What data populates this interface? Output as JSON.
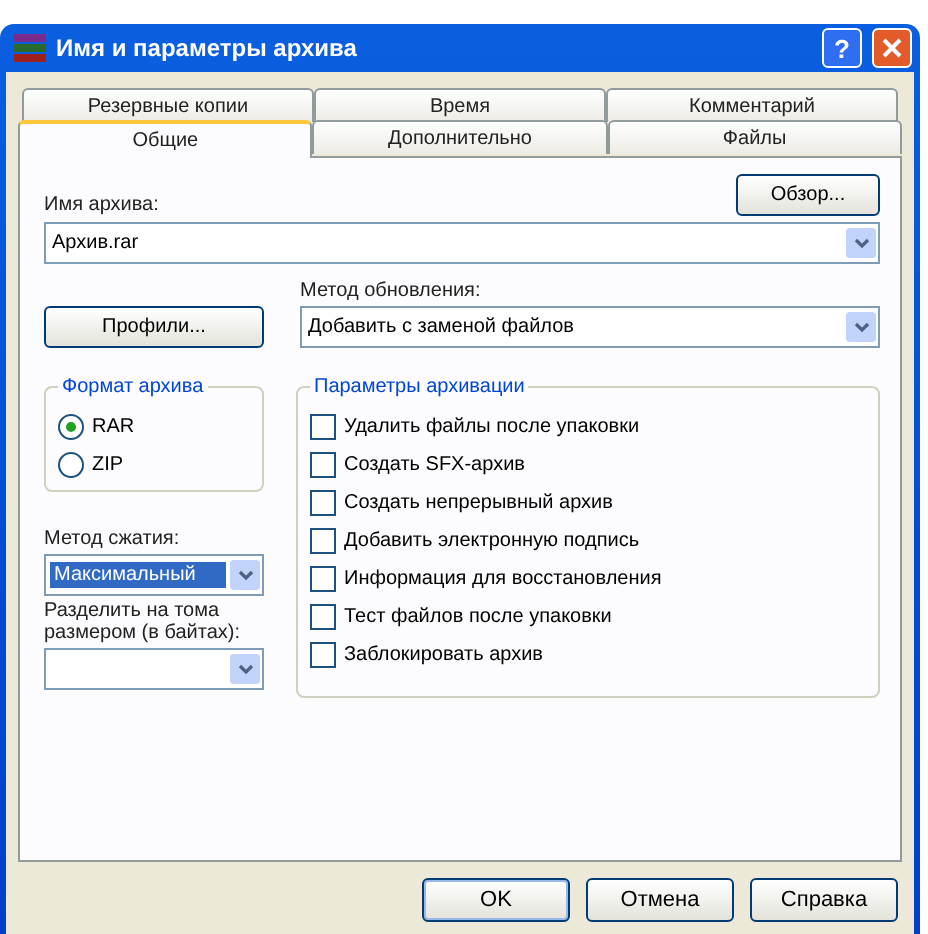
{
  "window": {
    "title": "Имя и параметры архива",
    "help": "?"
  },
  "tab_rows": [
    [
      {
        "label": "Резервные копии",
        "selected": false
      },
      {
        "label": "Время",
        "selected": false
      },
      {
        "label": "Комментарий",
        "selected": false
      }
    ],
    [
      {
        "label": "Общие",
        "selected": true
      },
      {
        "label": "Дополнительно",
        "selected": false
      },
      {
        "label": "Файлы",
        "selected": false
      }
    ]
  ],
  "archive_name": {
    "label": "Имя архива:",
    "value": "Архив.rar",
    "browse": "Обзор..."
  },
  "profiles_button": "Профили...",
  "update_method": {
    "label": "Метод обновления:",
    "value": "Добавить с заменой файлов"
  },
  "archive_format": {
    "title": "Формат архива",
    "options": [
      {
        "label": "RAR",
        "selected": true
      },
      {
        "label": "ZIP",
        "selected": false
      }
    ]
  },
  "compression_method": {
    "label": "Метод сжатия:",
    "value": "Максимальный"
  },
  "split_volumes": {
    "label": "Разделить на тома размером (в байтах):"
  },
  "archive_options": {
    "title": "Параметры архивации",
    "items": [
      {
        "label": "Удалить файлы после упаковки",
        "checked": false
      },
      {
        "label": "Создать SFX-архив",
        "checked": false
      },
      {
        "label": "Создать непрерывный архив",
        "checked": false
      },
      {
        "label": "Добавить электронную подпись",
        "checked": false
      },
      {
        "label": "Информация для восстановления",
        "checked": false
      },
      {
        "label": "Тест файлов после упаковки",
        "checked": false
      },
      {
        "label": "Заблокировать архив",
        "checked": false
      }
    ]
  },
  "buttons": [
    "OK",
    "Отмена",
    "Справка"
  ]
}
